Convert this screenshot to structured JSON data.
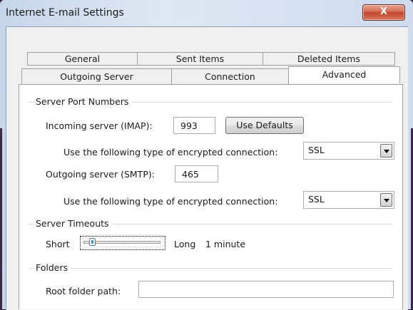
{
  "window": {
    "title": "Internet E-mail Settings",
    "close_glyph": "X"
  },
  "tabs": {
    "row_back": [
      {
        "label": "General"
      },
      {
        "label": "Sent Items"
      },
      {
        "label": "Deleted Items"
      }
    ],
    "row_front": [
      {
        "label": "Outgoing Server"
      },
      {
        "label": "Connection"
      },
      {
        "label": "Advanced",
        "active": true
      }
    ]
  },
  "server_ports": {
    "group_label": "Server Port Numbers",
    "incoming_label": "Incoming server (IMAP):",
    "incoming_value": "993",
    "use_defaults_label": "Use Defaults",
    "incoming_encryption_label": "Use the following type of encrypted connection:",
    "incoming_encryption_value": "SSL",
    "outgoing_label": "Outgoing server (SMTP):",
    "outgoing_value": "465",
    "outgoing_encryption_label": "Use the following type of encrypted connection:",
    "outgoing_encryption_value": "SSL"
  },
  "timeouts": {
    "group_label": "Server Timeouts",
    "short_label": "Short",
    "long_label": "Long",
    "value_label": "1 minute",
    "slider_fraction": 0.08
  },
  "folders": {
    "group_label": "Folders",
    "root_path_label": "Root folder path:",
    "root_path_value": ""
  },
  "icons": {
    "close": "close-icon",
    "dropdown": "chevron-down-icon"
  }
}
